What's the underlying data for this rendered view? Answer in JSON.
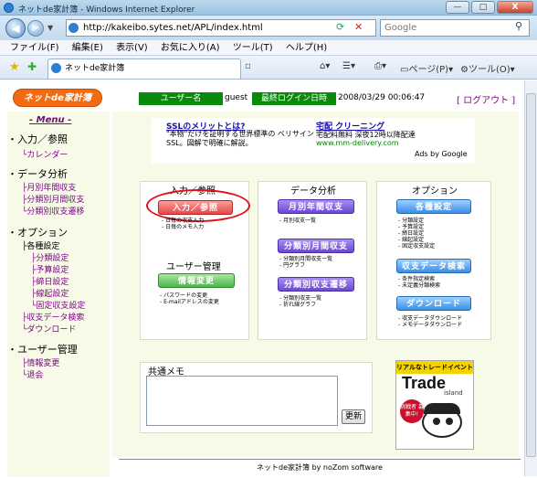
{
  "window": {
    "title": "ネットde家計簿 - Windows Internet Explorer",
    "minimize": "—",
    "maximize": "□",
    "close": "X"
  },
  "browser": {
    "url": "http://kakeibo.sytes.net/APL/index.html",
    "search_placeholder": "Google",
    "tab_title": "ネットde家計簿",
    "menu": [
      "ファイル(F)",
      "編集(E)",
      "表示(V)",
      "お気に入り(A)",
      "ツール(T)",
      "ヘルプ(H)"
    ],
    "toolbar": {
      "page": "ページ(P)",
      "tools": "ツール(O)"
    }
  },
  "header": {
    "logo": "ネットde家計簿",
    "user_label": "ユーザー名",
    "user": "guest",
    "login_label": "最終ログイン日時",
    "login_time": "2008/03/29 00:06:47",
    "logout": "[ ログアウト ]"
  },
  "sidebar": {
    "menu_title": "Menu",
    "section1": "・入力／参照",
    "s1_items": [
      "カレンダー"
    ],
    "section2": "・データ分析",
    "s2_items": [
      "月別年間収支",
      "分類別月間収支",
      "分類別収支遷移"
    ],
    "section3": "・オプション",
    "s3_group": "各種設定",
    "s3_sub": [
      "分類設定",
      "予算設定",
      "締日設定",
      "線起設定",
      "固定収支設定"
    ],
    "s3_items": [
      "収支データ検索",
      "ダウンロード"
    ],
    "section4": "・ユーザー管理",
    "s4_items": [
      "情報変更",
      "退会"
    ]
  },
  "ad": {
    "line1": "SSLのメリットとは?",
    "line2": "\"本物\"だけを証明する世界標準の ベリサイン SSL。図解で明確に解説。",
    "line3": "宅配 クリーニング",
    "line4": "宅配料無料 深夜12時以降配達",
    "line5": "www.mm-delivery.com",
    "adsby": "Ads by Google"
  },
  "panels": {
    "input": {
      "title": "入力／参照",
      "button": "入力／参照",
      "desc": [
        "日毎の収支入力",
        "日毎のメモ入力"
      ]
    },
    "user": {
      "title": "ユーザー管理",
      "button": "情報変更",
      "desc": [
        "パスワードの変更",
        "E-mailアドレスの変更"
      ]
    },
    "analysis": {
      "title": "データ分析",
      "b1": "月別年間収支",
      "d1": [
        "月別収支一覧"
      ],
      "b2": "分類別月間収支",
      "d2": [
        "分類別月間収支一覧",
        "円グラフ"
      ],
      "b3": "分類別収支遷移",
      "d3": [
        "分類別収支一覧",
        "折れ線グラフ"
      ]
    },
    "option": {
      "title": "オプション",
      "b1": "各種設定",
      "d1": [
        "分類設定",
        "予算設定",
        "締日設定",
        "線起設定",
        "固定収支設定"
      ],
      "b2": "収支データ検索",
      "d2": [
        "条件指定検索",
        "未定義分類検索"
      ],
      "b3": "ダウンロード",
      "d3": [
        "収支データダウンロード",
        "メモデータダウンロード"
      ]
    }
  },
  "memo": {
    "title": "共通メモ",
    "update": "更新"
  },
  "banner": {
    "top": "リアルなトレードイベント",
    "main": "Trade",
    "sub": "island",
    "badge": "挑戦者 募集中!"
  },
  "footer": "ネットde家計簿 by noZom software"
}
